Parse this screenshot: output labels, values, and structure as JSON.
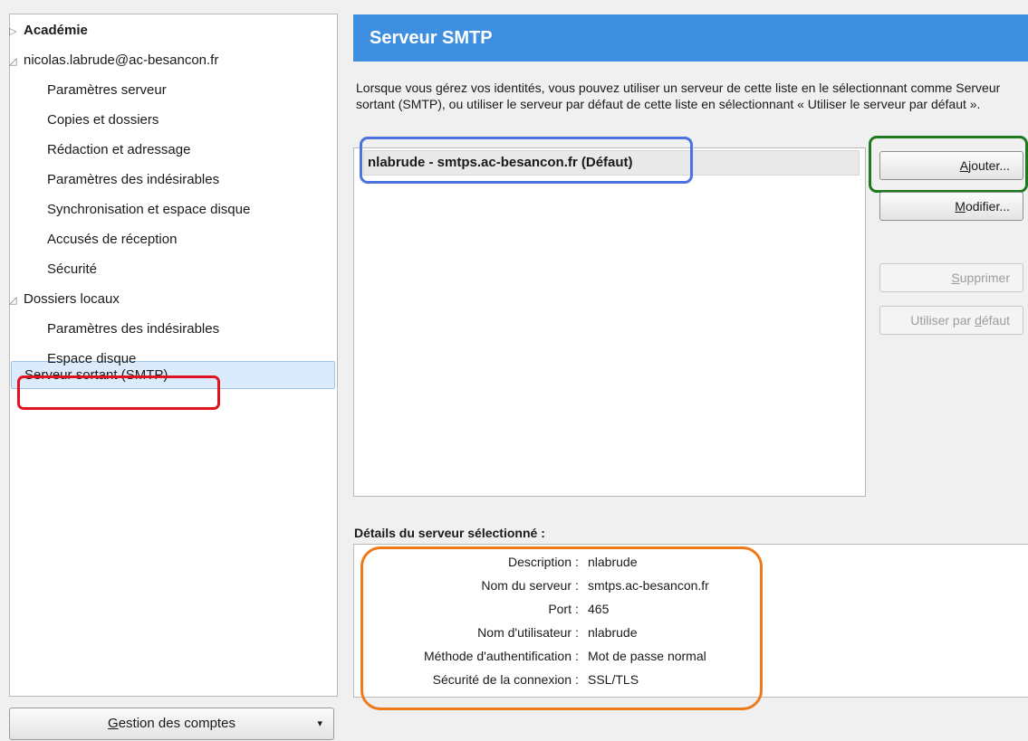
{
  "tree": {
    "items": [
      {
        "label": "Académie",
        "toggle": "▷",
        "bold": true
      },
      {
        "label": "nicolas.labrude@ac-besancon.fr",
        "toggle": "◿"
      },
      {
        "label": "Paramètres serveur"
      },
      {
        "label": "Copies et dossiers"
      },
      {
        "label": "Rédaction et adressage"
      },
      {
        "label": "Paramètres des indésirables"
      },
      {
        "label": "Synchronisation et espace disque"
      },
      {
        "label": "Accusés de réception"
      },
      {
        "label": "Sécurité"
      },
      {
        "label": "Dossiers locaux",
        "toggle": "◿"
      },
      {
        "label": "Paramètres des indésirables"
      },
      {
        "label": "Espace disque"
      },
      {
        "label": "Serveur sortant (SMTP)",
        "selected": true
      }
    ]
  },
  "manage_accounts": {
    "prefix": "G",
    "rest": "estion des comptes",
    "arrow": "▾"
  },
  "panel": {
    "title": "Serveur SMTP",
    "description": "Lorsque vous gérez vos identités, vous pouvez utiliser un serveur de cette liste en le sélectionnant comme Serveur sortant (SMTP), ou utiliser le serveur par défaut de cette liste en sélectionnant « Utiliser le serveur par défaut »."
  },
  "smtp_list": [
    "nlabrude - smtps.ac-besancon.fr (Défaut)"
  ],
  "buttons": {
    "add": {
      "pre": "",
      "acc": "A",
      "post": "jouter..."
    },
    "edit": {
      "pre": "",
      "acc": "M",
      "post": "odifier..."
    },
    "delete": {
      "pre": "",
      "acc": "S",
      "post": "upprimer"
    },
    "set_default": {
      "pre": "Utiliser par ",
      "acc": "d",
      "post": "éfaut"
    }
  },
  "details": {
    "title": "Détails du serveur sélectionné :",
    "rows": [
      {
        "label": "Description",
        "value": "nlabrude"
      },
      {
        "label": "Nom du serveur",
        "value": "smtps.ac-besancon.fr"
      },
      {
        "label": "Port",
        "value": "465"
      },
      {
        "label": "Nom d'utilisateur",
        "value": "nlabrude"
      },
      {
        "label": "Méthode d'authentification",
        "value": "Mot de passe normal"
      },
      {
        "label": "Sécurité de la connexion",
        "value": "SSL/TLS"
      }
    ]
  },
  "highlight_colors": {
    "red": "#e0141e",
    "blue": "#4b73e0",
    "green": "#1e7a1e",
    "orange": "#ef7a1a",
    "header": "#3f8fe0"
  }
}
